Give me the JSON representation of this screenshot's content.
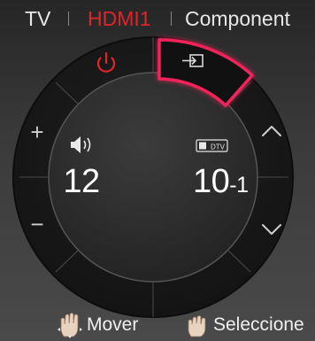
{
  "source_tabs": [
    {
      "label": "TV",
      "active": false
    },
    {
      "label": "HDMI1",
      "active": true
    },
    {
      "label": "Component",
      "active": false
    }
  ],
  "dial": {
    "buttons": {
      "power": {
        "icon": "power-icon",
        "color": "#e0242b"
      },
      "input": {
        "icon": "input-icon",
        "selected": true,
        "highlight_color": "#f0245a"
      },
      "volume_up": {
        "label": "+"
      },
      "volume_down": {
        "label": "−"
      },
      "channel_up": {
        "icon": "chevron-up-icon"
      },
      "channel_down": {
        "icon": "chevron-down-icon"
      }
    },
    "volume": {
      "icon": "speaker-icon",
      "value": "12"
    },
    "channel": {
      "icon": "dtv-icon",
      "badge": "DTV",
      "number": "10",
      "suffix": "-1"
    }
  },
  "hints": [
    {
      "icon": "hand-move-icon",
      "label": "Mover"
    },
    {
      "icon": "hand-select-icon",
      "label": "Seleccione"
    }
  ]
}
